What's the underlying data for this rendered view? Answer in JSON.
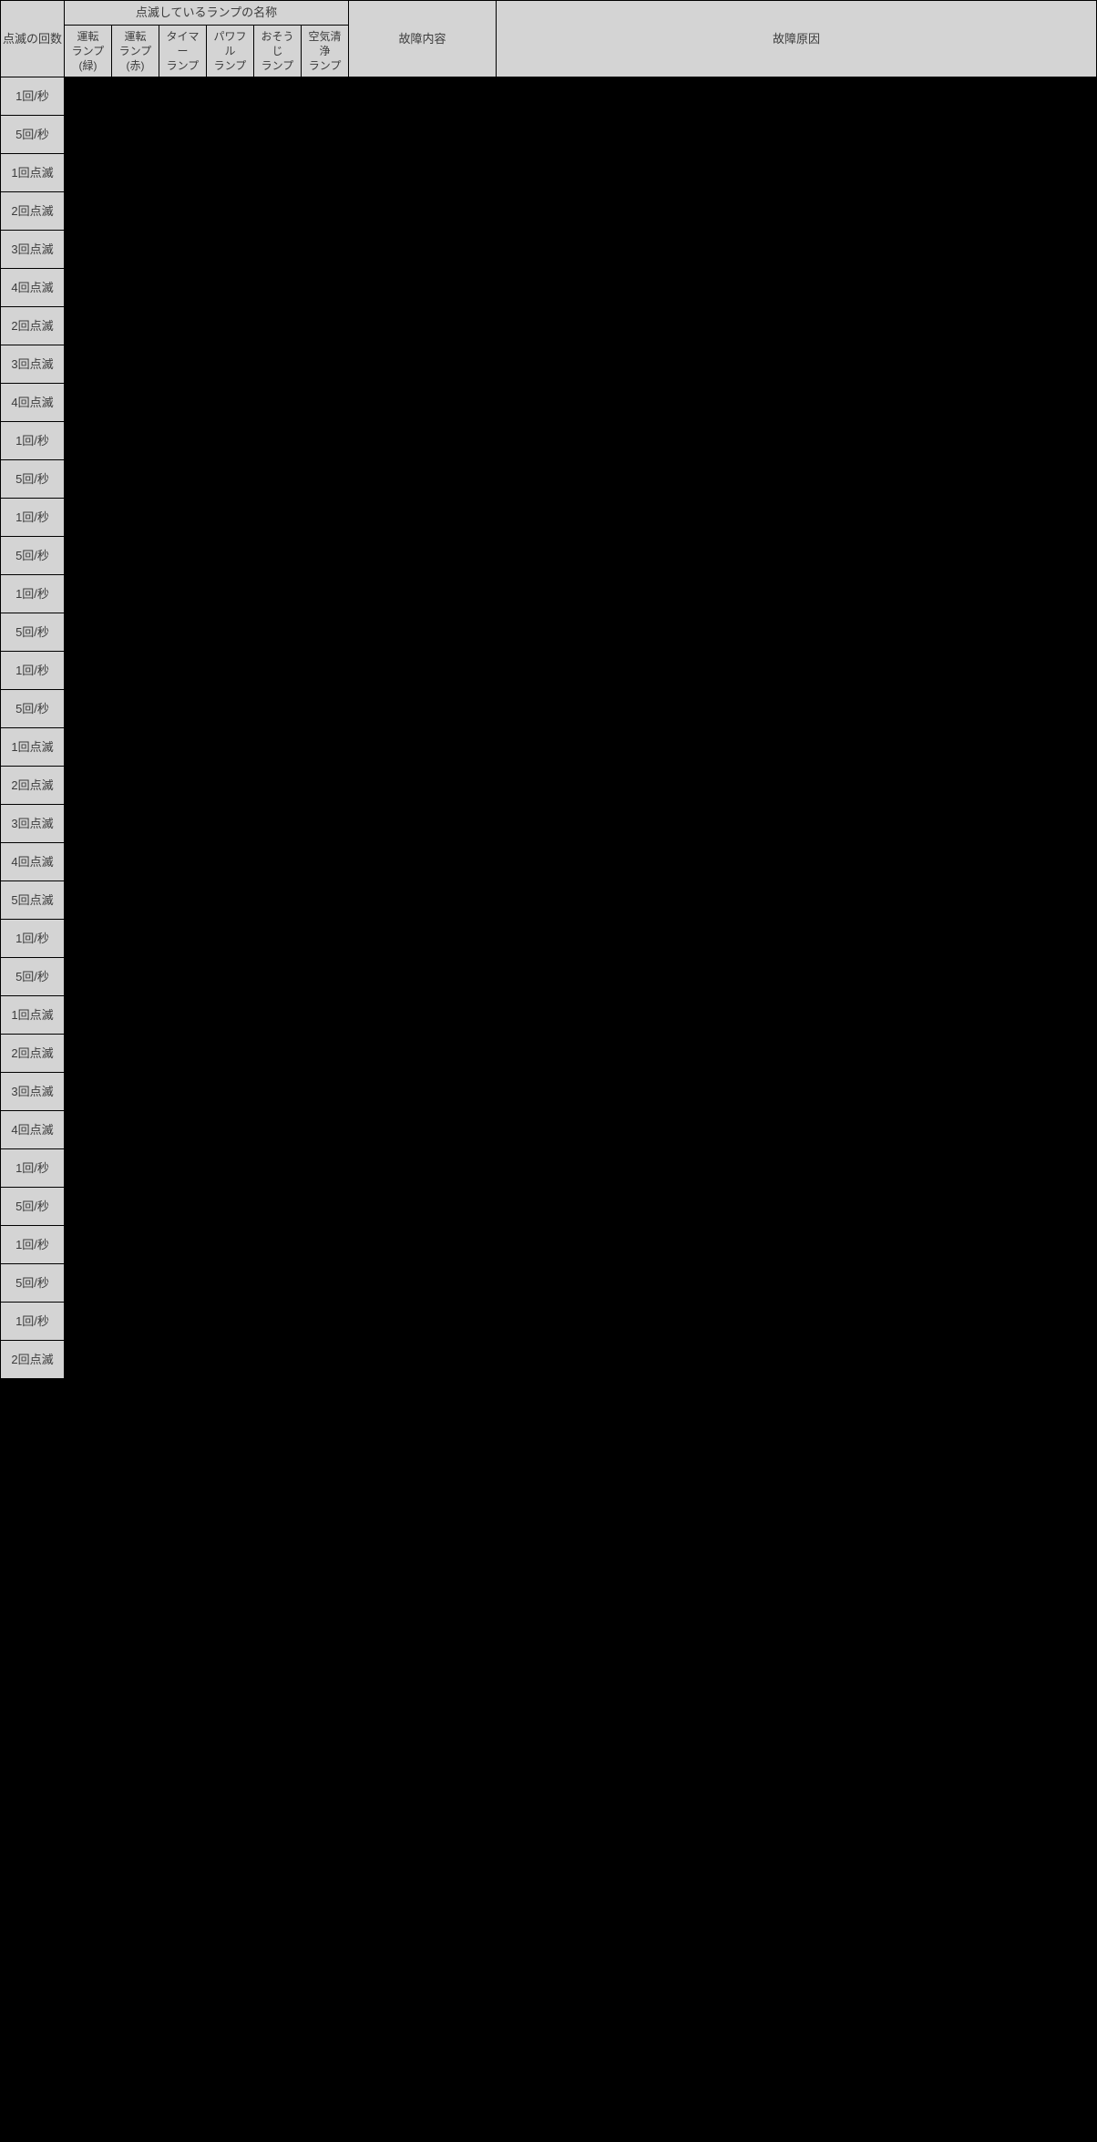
{
  "headers": {
    "count": "点滅の回数",
    "lamp_group": "点滅しているランプの名称",
    "lamp1": "運転\nランプ(緑)",
    "lamp2": "運転\nランプ(赤)",
    "lamp3": "タイマー\nランプ",
    "lamp4": "パワフル\nランプ",
    "lamp5": "おそうじ\nランプ",
    "lamp6": "空気清浄\nランプ",
    "content": "故障内容",
    "cause": "故障原因"
  },
  "rows": [
    {
      "count": "1回/秒"
    },
    {
      "count": "5回/秒"
    },
    {
      "count": "1回点滅"
    },
    {
      "count": "2回点滅"
    },
    {
      "count": "3回点滅"
    },
    {
      "count": "4回点滅"
    },
    {
      "count": "2回点滅"
    },
    {
      "count": "3回点滅"
    },
    {
      "count": "4回点滅"
    },
    {
      "count": "1回/秒"
    },
    {
      "count": "5回/秒"
    },
    {
      "count": "1回/秒"
    },
    {
      "count": "5回/秒"
    },
    {
      "count": "1回/秒"
    },
    {
      "count": "5回/秒"
    },
    {
      "count": "1回/秒"
    },
    {
      "count": "5回/秒"
    },
    {
      "count": "1回点滅"
    },
    {
      "count": "2回点滅"
    },
    {
      "count": "3回点滅"
    },
    {
      "count": "4回点滅"
    },
    {
      "count": "5回点滅"
    },
    {
      "count": "1回/秒"
    },
    {
      "count": "5回/秒"
    },
    {
      "count": "1回点滅"
    },
    {
      "count": "2回点滅"
    },
    {
      "count": "3回点滅"
    },
    {
      "count": "4回点滅"
    },
    {
      "count": "1回/秒"
    },
    {
      "count": "5回/秒"
    },
    {
      "count": "1回/秒"
    },
    {
      "count": "5回/秒"
    },
    {
      "count": "1回/秒"
    },
    {
      "count": "2回点滅"
    }
  ]
}
